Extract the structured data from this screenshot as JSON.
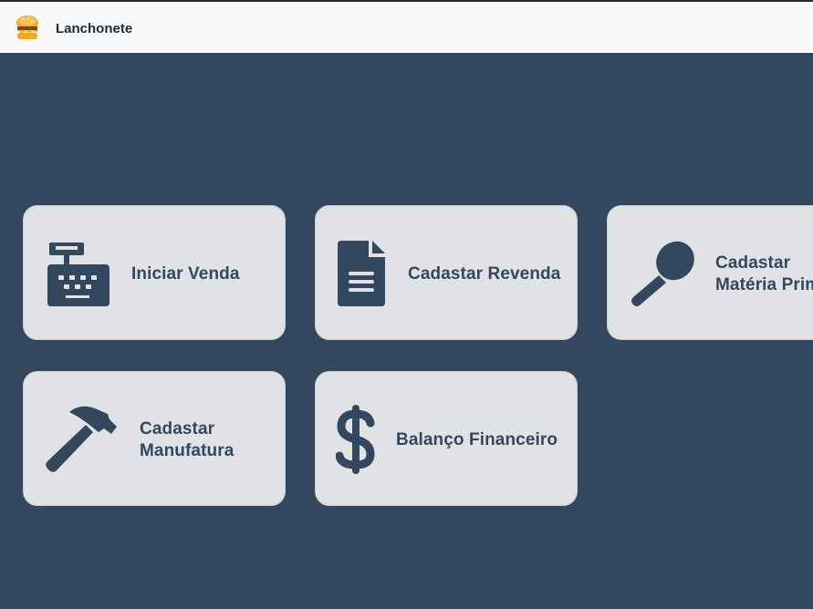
{
  "app": {
    "title": "Lanchonete",
    "logo_icon": "burger-logo-icon"
  },
  "menu": {
    "iniciar_venda": {
      "label": "Iniciar Venda",
      "icon": "cash-register-icon"
    },
    "cadastrar_revenda": {
      "label": "Cadastar Revenda",
      "icon": "document-icon"
    },
    "cadastrar_materia_prima": {
      "line1": "Cadastar",
      "line2": "Matéria Prima",
      "icon": "spoon-icon"
    },
    "cadastrar_manufatura": {
      "line1": "Cadastar",
      "line2": "Manufatura",
      "icon": "hammer-icon"
    },
    "balanco_financeiro": {
      "label": "Balanço Financeiro",
      "icon": "dollar-icon"
    }
  },
  "colors": {
    "background": "#33475e",
    "card": "#e1e2e5",
    "accent": "#33475e",
    "topbar": "#f8f9fb"
  }
}
